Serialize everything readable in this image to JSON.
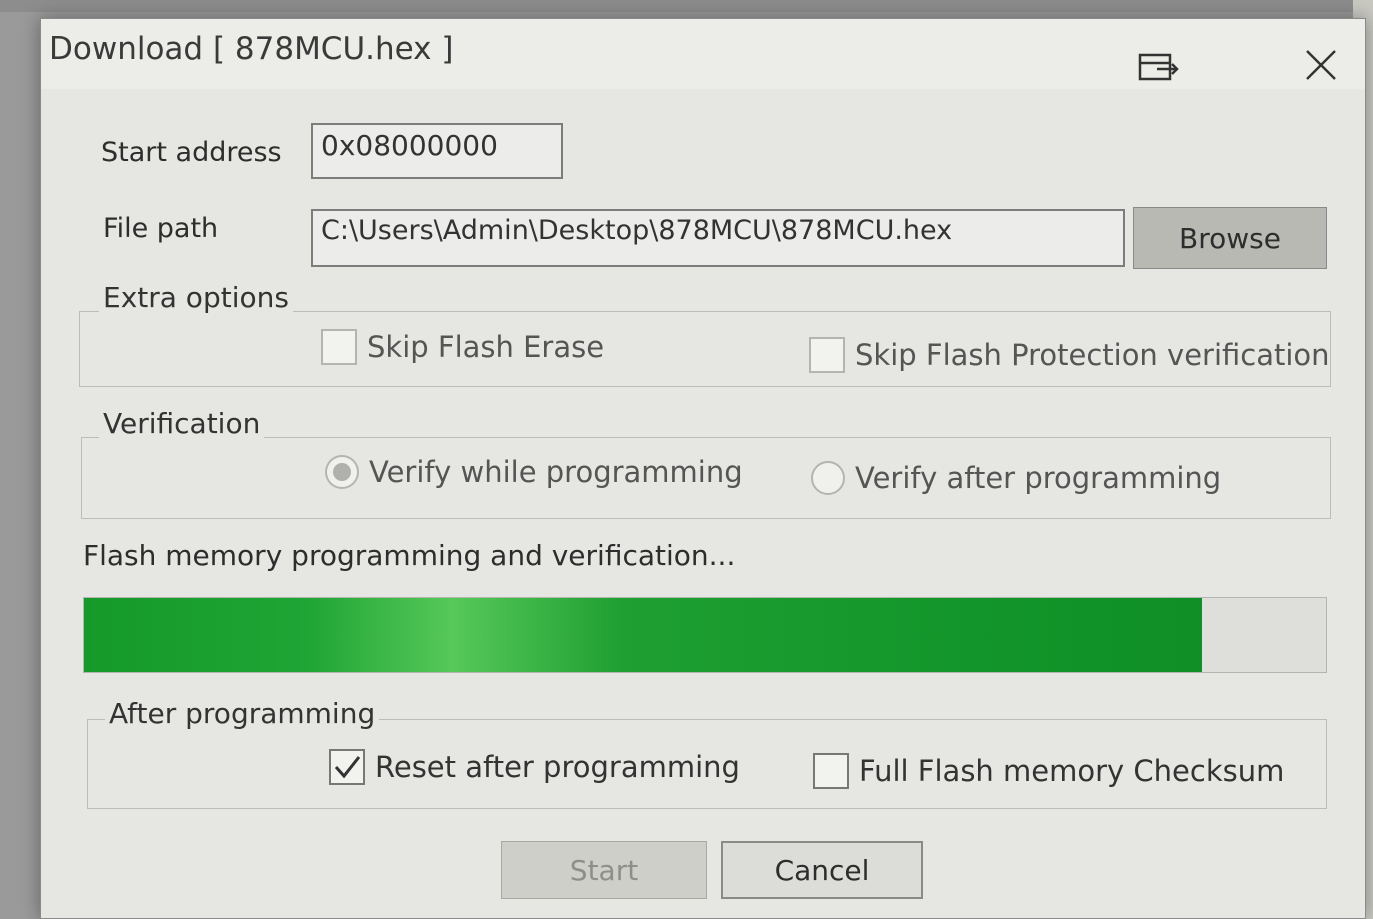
{
  "window": {
    "title": "Download [ 878MCU.hex ]"
  },
  "fields": {
    "start_address_label": "Start address",
    "start_address_value": "0x08000000",
    "file_path_label": "File path",
    "file_path_value": "C:\\Users\\Admin\\Desktop\\878MCU\\878MCU.hex",
    "browse_label": "Browse"
  },
  "extra_options": {
    "legend": "Extra options",
    "skip_flash_erase": {
      "label": "Skip Flash Erase",
      "checked": false
    },
    "skip_flash_protection": {
      "label": "Skip Flash Protection verification",
      "checked": false
    }
  },
  "verification": {
    "legend": "Verification",
    "verify_while": {
      "label": "Verify while programming",
      "selected": true
    },
    "verify_after": {
      "label": "Verify after programming",
      "selected": false
    }
  },
  "progress": {
    "status_text": "Flash memory programming and verification...",
    "fraction": 0.9,
    "color": "#159a2a"
  },
  "after_programming": {
    "legend": "After programming",
    "reset_after": {
      "label": "Reset after programming",
      "checked": true
    },
    "full_checksum": {
      "label": "Full Flash memory Checksum",
      "checked": false
    }
  },
  "buttons": {
    "start_label": "Start",
    "cancel_label": "Cancel"
  },
  "icons": {
    "restore": "window-restore-icon",
    "close": "close-icon",
    "check": "checkmark-icon"
  }
}
